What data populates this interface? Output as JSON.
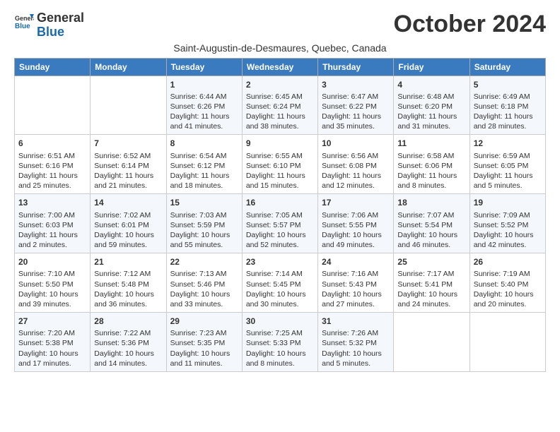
{
  "logo": {
    "line1": "General",
    "line2": "Blue"
  },
  "title": "October 2024",
  "location": "Saint-Augustin-de-Desmaures, Quebec, Canada",
  "weekdays": [
    "Sunday",
    "Monday",
    "Tuesday",
    "Wednesday",
    "Thursday",
    "Friday",
    "Saturday"
  ],
  "weeks": [
    [
      {
        "day": "",
        "content": ""
      },
      {
        "day": "",
        "content": ""
      },
      {
        "day": "1",
        "content": "Sunrise: 6:44 AM\nSunset: 6:26 PM\nDaylight: 11 hours and 41 minutes."
      },
      {
        "day": "2",
        "content": "Sunrise: 6:45 AM\nSunset: 6:24 PM\nDaylight: 11 hours and 38 minutes."
      },
      {
        "day": "3",
        "content": "Sunrise: 6:47 AM\nSunset: 6:22 PM\nDaylight: 11 hours and 35 minutes."
      },
      {
        "day": "4",
        "content": "Sunrise: 6:48 AM\nSunset: 6:20 PM\nDaylight: 11 hours and 31 minutes."
      },
      {
        "day": "5",
        "content": "Sunrise: 6:49 AM\nSunset: 6:18 PM\nDaylight: 11 hours and 28 minutes."
      }
    ],
    [
      {
        "day": "6",
        "content": "Sunrise: 6:51 AM\nSunset: 6:16 PM\nDaylight: 11 hours and 25 minutes."
      },
      {
        "day": "7",
        "content": "Sunrise: 6:52 AM\nSunset: 6:14 PM\nDaylight: 11 hours and 21 minutes."
      },
      {
        "day": "8",
        "content": "Sunrise: 6:54 AM\nSunset: 6:12 PM\nDaylight: 11 hours and 18 minutes."
      },
      {
        "day": "9",
        "content": "Sunrise: 6:55 AM\nSunset: 6:10 PM\nDaylight: 11 hours and 15 minutes."
      },
      {
        "day": "10",
        "content": "Sunrise: 6:56 AM\nSunset: 6:08 PM\nDaylight: 11 hours and 12 minutes."
      },
      {
        "day": "11",
        "content": "Sunrise: 6:58 AM\nSunset: 6:06 PM\nDaylight: 11 hours and 8 minutes."
      },
      {
        "day": "12",
        "content": "Sunrise: 6:59 AM\nSunset: 6:05 PM\nDaylight: 11 hours and 5 minutes."
      }
    ],
    [
      {
        "day": "13",
        "content": "Sunrise: 7:00 AM\nSunset: 6:03 PM\nDaylight: 11 hours and 2 minutes."
      },
      {
        "day": "14",
        "content": "Sunrise: 7:02 AM\nSunset: 6:01 PM\nDaylight: 10 hours and 59 minutes."
      },
      {
        "day": "15",
        "content": "Sunrise: 7:03 AM\nSunset: 5:59 PM\nDaylight: 10 hours and 55 minutes."
      },
      {
        "day": "16",
        "content": "Sunrise: 7:05 AM\nSunset: 5:57 PM\nDaylight: 10 hours and 52 minutes."
      },
      {
        "day": "17",
        "content": "Sunrise: 7:06 AM\nSunset: 5:55 PM\nDaylight: 10 hours and 49 minutes."
      },
      {
        "day": "18",
        "content": "Sunrise: 7:07 AM\nSunset: 5:54 PM\nDaylight: 10 hours and 46 minutes."
      },
      {
        "day": "19",
        "content": "Sunrise: 7:09 AM\nSunset: 5:52 PM\nDaylight: 10 hours and 42 minutes."
      }
    ],
    [
      {
        "day": "20",
        "content": "Sunrise: 7:10 AM\nSunset: 5:50 PM\nDaylight: 10 hours and 39 minutes."
      },
      {
        "day": "21",
        "content": "Sunrise: 7:12 AM\nSunset: 5:48 PM\nDaylight: 10 hours and 36 minutes."
      },
      {
        "day": "22",
        "content": "Sunrise: 7:13 AM\nSunset: 5:46 PM\nDaylight: 10 hours and 33 minutes."
      },
      {
        "day": "23",
        "content": "Sunrise: 7:14 AM\nSunset: 5:45 PM\nDaylight: 10 hours and 30 minutes."
      },
      {
        "day": "24",
        "content": "Sunrise: 7:16 AM\nSunset: 5:43 PM\nDaylight: 10 hours and 27 minutes."
      },
      {
        "day": "25",
        "content": "Sunrise: 7:17 AM\nSunset: 5:41 PM\nDaylight: 10 hours and 24 minutes."
      },
      {
        "day": "26",
        "content": "Sunrise: 7:19 AM\nSunset: 5:40 PM\nDaylight: 10 hours and 20 minutes."
      }
    ],
    [
      {
        "day": "27",
        "content": "Sunrise: 7:20 AM\nSunset: 5:38 PM\nDaylight: 10 hours and 17 minutes."
      },
      {
        "day": "28",
        "content": "Sunrise: 7:22 AM\nSunset: 5:36 PM\nDaylight: 10 hours and 14 minutes."
      },
      {
        "day": "29",
        "content": "Sunrise: 7:23 AM\nSunset: 5:35 PM\nDaylight: 10 hours and 11 minutes."
      },
      {
        "day": "30",
        "content": "Sunrise: 7:25 AM\nSunset: 5:33 PM\nDaylight: 10 hours and 8 minutes."
      },
      {
        "day": "31",
        "content": "Sunrise: 7:26 AM\nSunset: 5:32 PM\nDaylight: 10 hours and 5 minutes."
      },
      {
        "day": "",
        "content": ""
      },
      {
        "day": "",
        "content": ""
      }
    ]
  ]
}
